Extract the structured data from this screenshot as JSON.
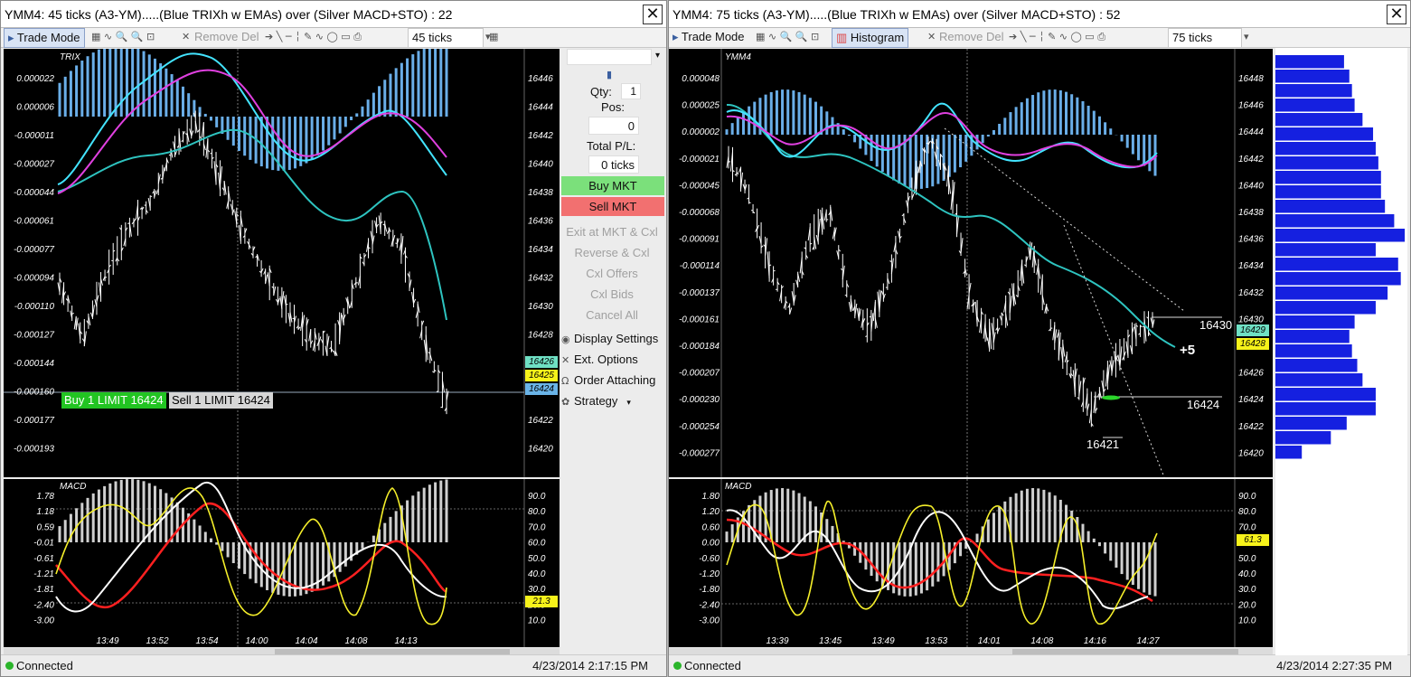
{
  "left": {
    "title": "YMM4: 45 ticks (A3-YM).....(Blue TRIXh w EMAs) over (Silver MACD+STO) : 22",
    "close_glyph": "✕",
    "toolbar": {
      "trade_mode": "Trade Mode",
      "remove_del": "Remove Del",
      "interval": "45 ticks"
    },
    "top_chart": {
      "indicator": "TRIX",
      "left_ticks": [
        "0.000022",
        "0.000006",
        "-0.000011",
        "-0.000027",
        "-0.000044",
        "-0.000061",
        "-0.000077",
        "-0.000094",
        "-0.000110",
        "-0.000127",
        "-0.000144",
        "-0.000160",
        "-0.000177",
        "-0.000193"
      ],
      "right_ticks": [
        "16446",
        "16444",
        "16442",
        "16440",
        "16438",
        "16436",
        "16434",
        "16432",
        "16430",
        "16428",
        "16426",
        "16424",
        "16422",
        "16420"
      ],
      "price_tags": [
        {
          "text": "16426",
          "color": "#6fe0c4"
        },
        {
          "text": "16425",
          "color": "#f6f21a"
        },
        {
          "text": "16424",
          "color": "#6ab4e8"
        }
      ],
      "buy_order": "Buy 1 LIMIT 16424",
      "sell_order": "Sell 1 LIMIT 16424"
    },
    "bottom_chart": {
      "indicator": "MACD",
      "left_ticks": [
        "1.78",
        "1.18",
        "0.59",
        "-0.01",
        "-0.61",
        "-1.21",
        "-1.81",
        "-2.40",
        "-3.00"
      ],
      "right_ticks": [
        "90.0",
        "80.0",
        "70.0",
        "60.0",
        "50.0",
        "40.0",
        "30.0",
        "20.0",
        "10.0"
      ],
      "sto_tag": "21.3",
      "time_labels": [
        "13:49",
        "13:52",
        "13:54",
        "14:00",
        "14:04",
        "14:08",
        "14:13"
      ]
    },
    "side_panel": {
      "qty_label": "Qty:",
      "qty_value": "1",
      "pos_label": "Pos:",
      "pos_value": "0",
      "pl_label": "Total P/L:",
      "pl_value": "0 ticks",
      "buy_mkt": "Buy MKT",
      "sell_mkt": "Sell MKT",
      "exit": "Exit at MKT & Cxl",
      "reverse": "Reverse & Cxl",
      "cxl_offers": "Cxl Offers",
      "cxl_bids": "Cxl Bids",
      "cancel_all": "Cancel All",
      "display_settings": "Display Settings",
      "ext_options": "Ext. Options",
      "order_attaching": "Order Attaching",
      "strategy": "Strategy"
    },
    "status": {
      "connected": "Connected",
      "time": "4/23/2014 2:17:15 PM"
    }
  },
  "right": {
    "title": "YMM4: 75 ticks (A3-YM).....(Blue TRIXh w EMAs) over (Silver MACD+STO) : 52",
    "close_glyph": "✕",
    "toolbar": {
      "trade_mode": "Trade Mode",
      "histogram": "Histogram",
      "remove_del": "Remove Del",
      "interval": "75 ticks"
    },
    "top_chart": {
      "indicator": "YMM4",
      "left_ticks": [
        "0.000048",
        "0.000025",
        "0.000002",
        "-0.000021",
        "-0.000045",
        "-0.000068",
        "-0.000091",
        "-0.000114",
        "-0.000137",
        "-0.000161",
        "-0.000184",
        "-0.000207",
        "-0.000230",
        "-0.000254",
        "-0.000277"
      ],
      "right_ticks": [
        "16448",
        "16446",
        "16444",
        "16442",
        "16440",
        "16438",
        "16436",
        "16434",
        "16432",
        "16430",
        "16428",
        "16426",
        "16424",
        "16422",
        "16420"
      ],
      "price_tags": [
        {
          "text": "16429",
          "color": "#6fe0c4"
        },
        {
          "text": "16428",
          "color": "#f6f21a"
        }
      ],
      "annot_high": "16430",
      "annot_plus": "+5",
      "annot_mid": "16424",
      "annot_low": "16421"
    },
    "bottom_chart": {
      "indicator": "MACD",
      "left_ticks": [
        "1.80",
        "1.20",
        "0.60",
        "0.00",
        "-0.60",
        "-1.20",
        "-1.80",
        "-2.40",
        "-3.00"
      ],
      "right_ticks": [
        "90.0",
        "80.0",
        "70.0",
        "60.0",
        "50.0",
        "40.0",
        "30.0",
        "20.0",
        "10.0"
      ],
      "sto_tag": "61.3",
      "time_labels": [
        "13:39",
        "13:45",
        "13:49",
        "13:53",
        "14:01",
        "14:08",
        "14:16",
        "14:27"
      ]
    },
    "volume_profile": [
      0.52,
      0.56,
      0.58,
      0.6,
      0.66,
      0.74,
      0.76,
      0.78,
      0.8,
      0.8,
      0.83,
      0.9,
      0.98,
      0.76,
      0.93,
      0.95,
      0.85,
      0.76,
      0.6,
      0.56,
      0.58,
      0.62,
      0.66,
      0.76,
      0.76,
      0.54,
      0.42,
      0.2
    ],
    "status": {
      "connected": "Connected",
      "time": "4/23/2014 2:27:35 PM"
    }
  }
}
